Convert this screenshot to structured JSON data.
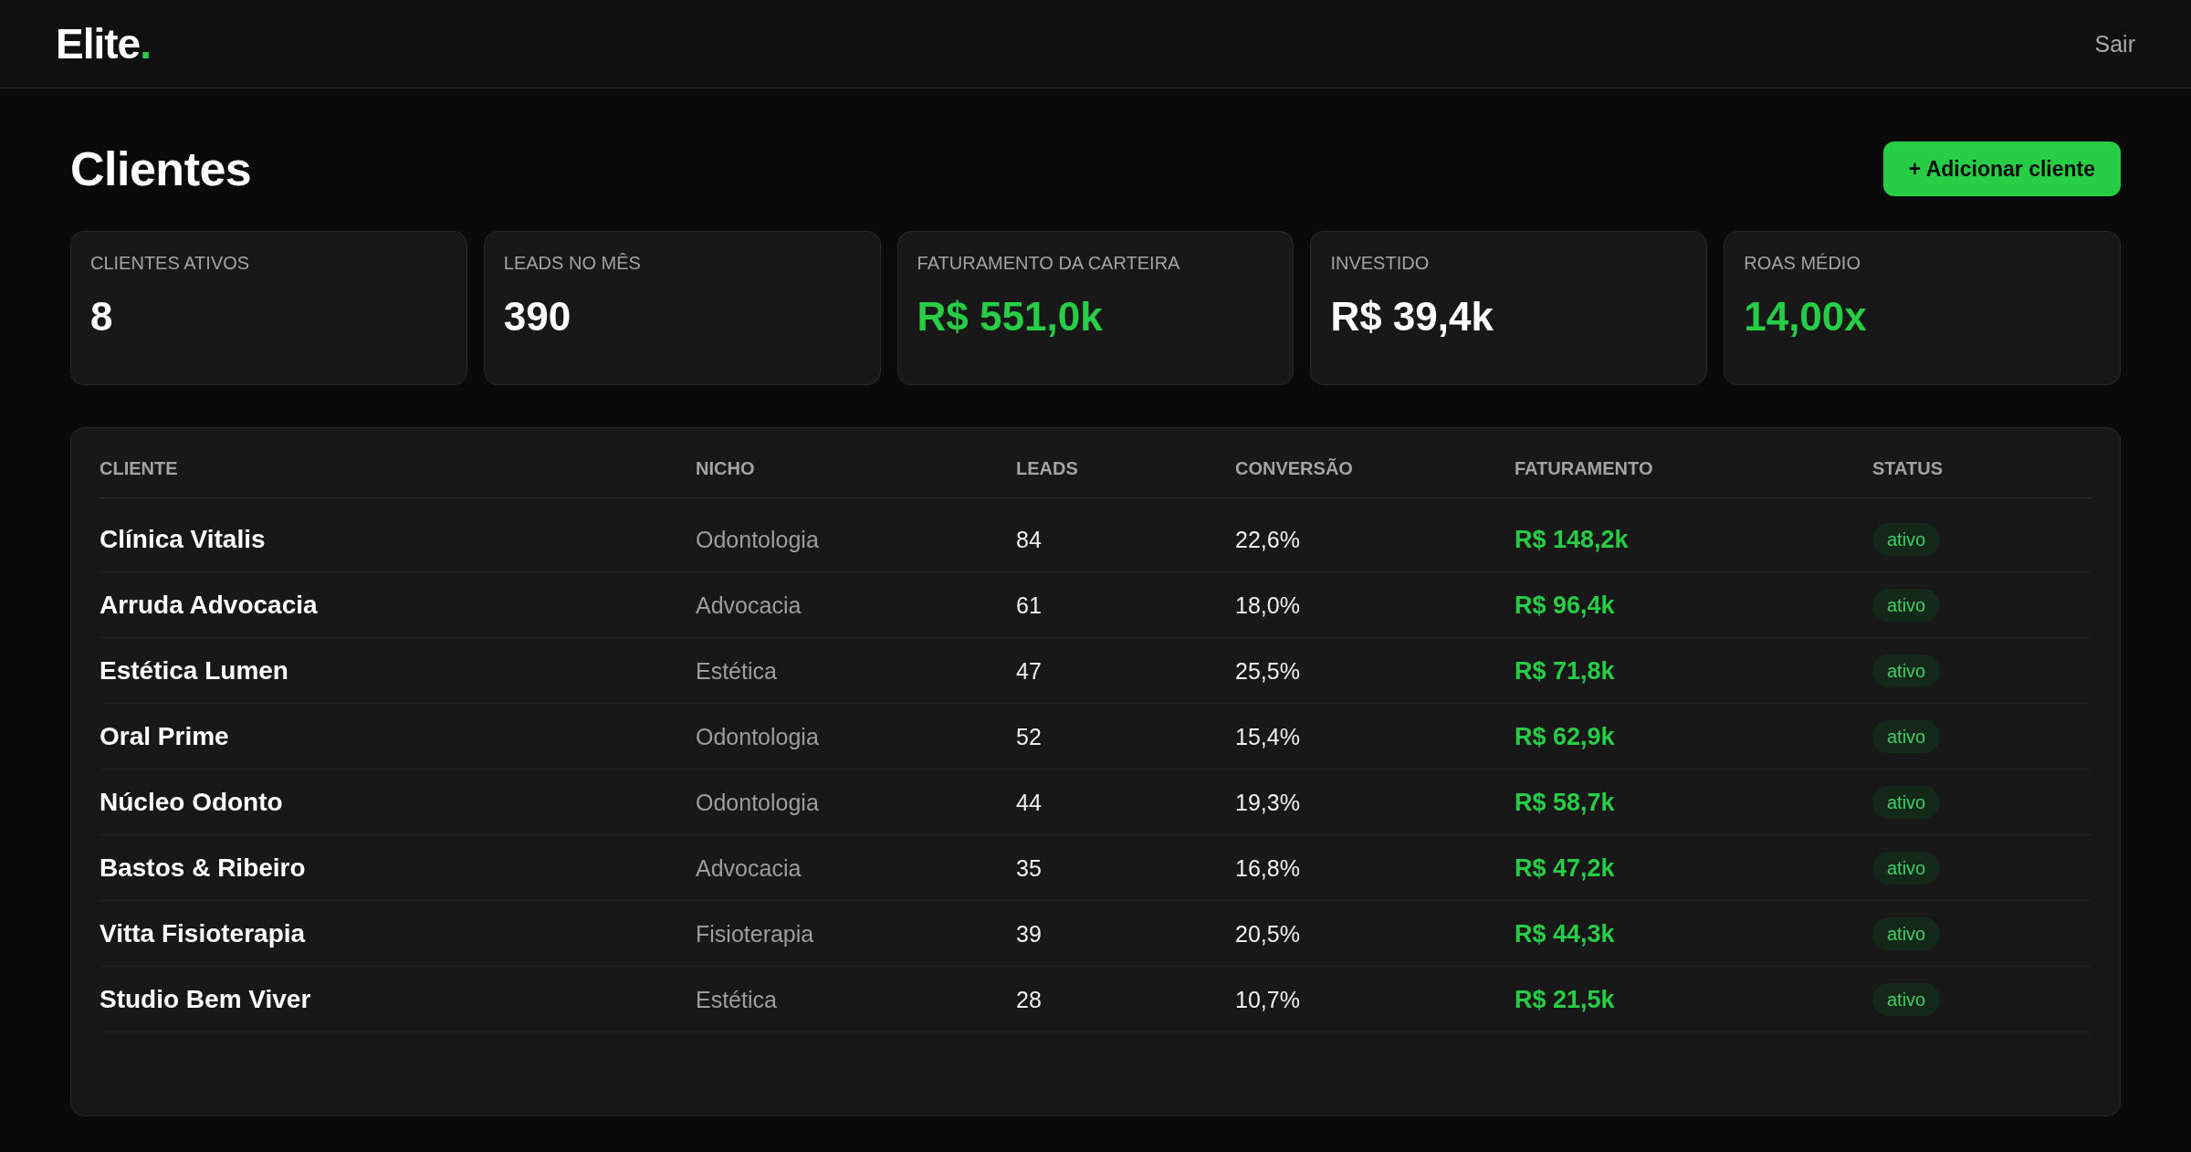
{
  "header": {
    "logo": {
      "text": "Elite",
      "accent": "."
    },
    "logout": "Sair"
  },
  "page": {
    "title": "Clientes",
    "add_button": "+ Adicionar cliente"
  },
  "stats": [
    {
      "label": "CLIENTES ATIVOS",
      "value": "8",
      "highlight": false
    },
    {
      "label": "LEADS NO MÊS",
      "value": "390",
      "highlight": false
    },
    {
      "label": "FATURAMENTO DA CARTEIRA",
      "value": "R$ 551,0k",
      "highlight": true
    },
    {
      "label": "INVESTIDO",
      "value": "R$ 39,4k",
      "highlight": false
    },
    {
      "label": "ROAS MÉDIO",
      "value": "14,00x",
      "highlight": true
    }
  ],
  "table": {
    "columns": [
      "CLIENTE",
      "NICHO",
      "LEADS",
      "CONVERSÃO",
      "FATURAMENTO",
      "STATUS"
    ],
    "rows": [
      {
        "cliente": "Clínica Vitalis",
        "nicho": "Odontologia",
        "leads": "84",
        "conversao": "22,6%",
        "faturamento": "R$ 148,2k",
        "status": "ativo"
      },
      {
        "cliente": "Arruda Advocacia",
        "nicho": "Advocacia",
        "leads": "61",
        "conversao": "18,0%",
        "faturamento": "R$ 96,4k",
        "status": "ativo"
      },
      {
        "cliente": "Estética Lumen",
        "nicho": "Estética",
        "leads": "47",
        "conversao": "25,5%",
        "faturamento": "R$ 71,8k",
        "status": "ativo"
      },
      {
        "cliente": "Oral Prime",
        "nicho": "Odontologia",
        "leads": "52",
        "conversao": "15,4%",
        "faturamento": "R$ 62,9k",
        "status": "ativo"
      },
      {
        "cliente": "Núcleo Odonto",
        "nicho": "Odontologia",
        "leads": "44",
        "conversao": "19,3%",
        "faturamento": "R$ 58,7k",
        "status": "ativo"
      },
      {
        "cliente": "Bastos & Ribeiro",
        "nicho": "Advocacia",
        "leads": "35",
        "conversao": "16,8%",
        "faturamento": "R$ 47,2k",
        "status": "ativo"
      },
      {
        "cliente": "Vitta Fisioterapia",
        "nicho": "Fisioterapia",
        "leads": "39",
        "conversao": "20,5%",
        "faturamento": "R$ 44,3k",
        "status": "ativo"
      },
      {
        "cliente": "Studio Bem Viver",
        "nicho": "Estética",
        "leads": "28",
        "conversao": "10,7%",
        "faturamento": "R$ 21,5k",
        "status": "ativo"
      }
    ]
  }
}
